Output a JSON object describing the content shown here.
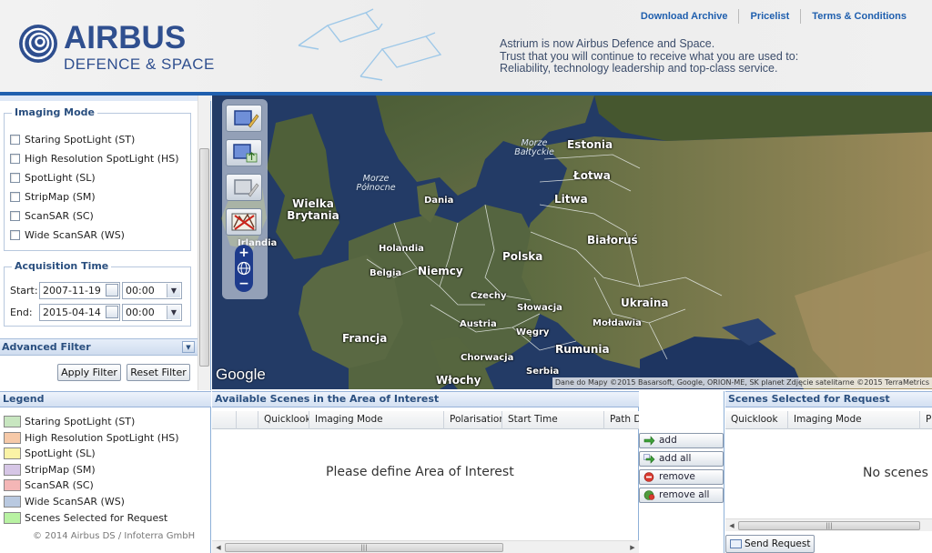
{
  "header": {
    "brand": "AIRBUS",
    "subbrand": "DEFENCE & SPACE",
    "links": [
      {
        "label": "Download Archive"
      },
      {
        "label": "Pricelist"
      },
      {
        "label": "Terms & Conditions"
      }
    ],
    "tagline": [
      "Astrium is now Airbus Defence and Space.",
      "Trust that you will continue to receive what you are used to:",
      "Reliability, technology leadership and top-class service."
    ]
  },
  "filters": {
    "imaging_mode": {
      "title": "Imaging Mode",
      "options": [
        {
          "label": "Staring SpotLight (ST)",
          "checked": false
        },
        {
          "label": "High Resolution SpotLight (HS)",
          "checked": false
        },
        {
          "label": "SpotLight (SL)",
          "checked": false
        },
        {
          "label": "StripMap (SM)",
          "checked": false
        },
        {
          "label": "ScanSAR (SC)",
          "checked": false
        },
        {
          "label": "Wide ScanSAR (WS)",
          "checked": false
        }
      ]
    },
    "acquisition_time": {
      "title": "Acquisition Time",
      "start_label": "Start:",
      "start_date": "2007-11-19",
      "start_time": "00:00",
      "end_label": "End:",
      "end_date": "2015-04-14",
      "end_time": "00:00"
    },
    "advanced_filter": "Advanced Filter",
    "apply_label": "Apply Filter",
    "reset_label": "Reset Filter"
  },
  "map": {
    "labels": [
      {
        "text": "Estonia"
      },
      {
        "text": "Łotwa"
      },
      {
        "text": "Litwa"
      },
      {
        "text": "Białoruś"
      },
      {
        "text": "Polska"
      },
      {
        "text": "Niemcy"
      },
      {
        "text": "Holandia"
      },
      {
        "text": "Belgia"
      },
      {
        "text": "Dania"
      },
      {
        "text": "Wielka Brytania"
      },
      {
        "text": "Irlandia"
      },
      {
        "text": "Czechy"
      },
      {
        "text": "Słowacja"
      },
      {
        "text": "Austria"
      },
      {
        "text": "Węgry"
      },
      {
        "text": "Mołdawia"
      },
      {
        "text": "Ukraina"
      },
      {
        "text": "Francja"
      },
      {
        "text": "Rumunia"
      },
      {
        "text": "Chorwacja"
      },
      {
        "text": "Serbia"
      },
      {
        "text": "Włochy"
      }
    ],
    "seas": [
      {
        "text": "Morze Bałtyckie"
      },
      {
        "text": "Morze Północne"
      }
    ],
    "google": "Google",
    "credit": "Dane do Mapy ©2015 Basarsoft, Google, ORION-ME, SK planet Zdjęcie satelitarne ©2015 TerraMetrics"
  },
  "legend": {
    "title": "Legend",
    "items": [
      {
        "label": "Staring SpotLight (ST)",
        "color": "#c8e6c0"
      },
      {
        "label": "High Resolution SpotLight (HS)",
        "color": "#f6c9a8"
      },
      {
        "label": "SpotLight (SL)",
        "color": "#faf3a6"
      },
      {
        "label": "StripMap (SM)",
        "color": "#d6c6e6"
      },
      {
        "label": "ScanSAR (SC)",
        "color": "#f4b6b6"
      },
      {
        "label": "Wide ScanSAR (WS)",
        "color": "#b9c9e0"
      },
      {
        "label": "Scenes Selected for Request",
        "color": "#b8f2a2"
      }
    ],
    "copyright": "© 2014 Airbus DS / Infoterra GmbH"
  },
  "available": {
    "title": "Available Scenes in the Area of Interest",
    "columns": [
      "Quicklook",
      "Imaging Mode",
      "Polarisation",
      "Start Time",
      "Path Di"
    ],
    "empty": "Please define Area of Interest"
  },
  "actions": {
    "add": "add",
    "add_all": "add all",
    "remove": "remove",
    "remove_all": "remove all"
  },
  "selected": {
    "title": "Scenes Selected for Request",
    "columns": [
      "Quicklook",
      "Imaging Mode",
      "P"
    ],
    "empty": "No scenes",
    "send": "Send Request"
  },
  "colors": {
    "brand": "#2f4f8f",
    "accent": "#1f5fae",
    "panel_head": "#2a4f7f"
  }
}
